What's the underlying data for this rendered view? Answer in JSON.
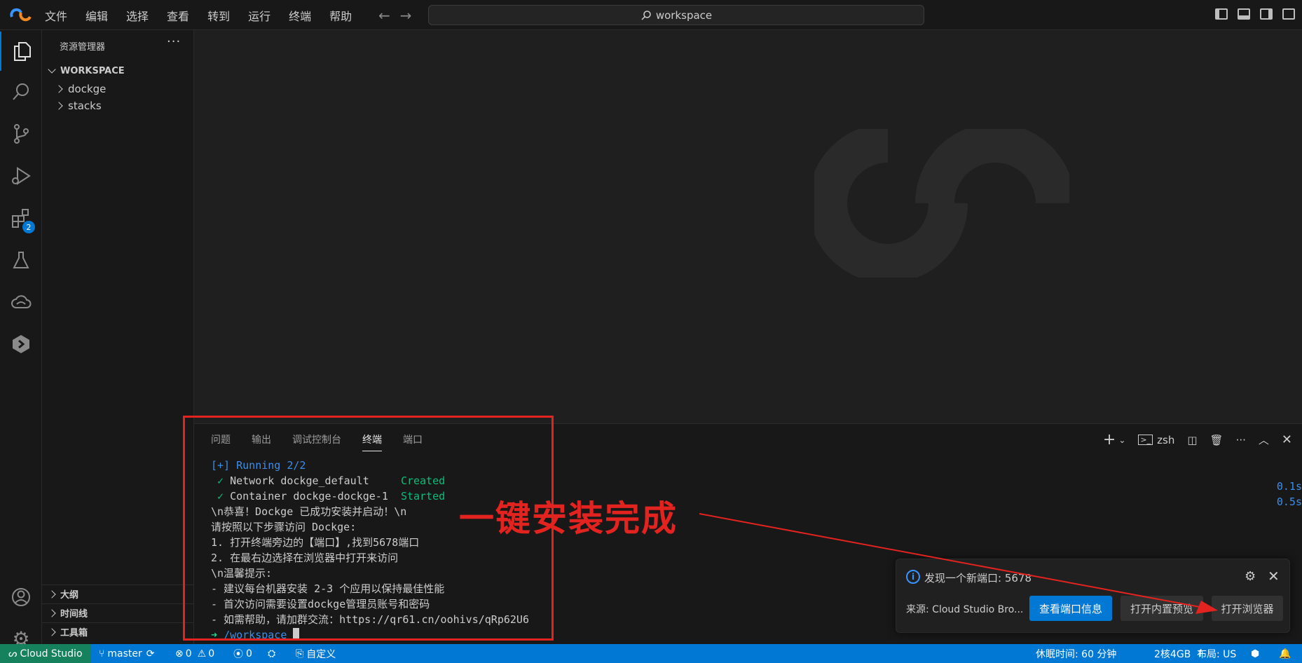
{
  "menu": [
    "文件",
    "编辑",
    "选择",
    "查看",
    "转到",
    "运行",
    "终端",
    "帮助"
  ],
  "search": {
    "text": "workspace"
  },
  "activity": {
    "extensions_badge": "2"
  },
  "sidebar": {
    "title": "资源管理器",
    "more": "···",
    "workspace_label": "WORKSPACE",
    "folders": [
      "dockge",
      "stacks"
    ],
    "sections": [
      "大纲",
      "时间线",
      "工具箱"
    ]
  },
  "panel": {
    "tabs": [
      "问题",
      "输出",
      "调试控制台",
      "终端",
      "端口"
    ],
    "active_tab": "终端",
    "shell": "zsh"
  },
  "terminal": {
    "running": "[+] Running 2/2",
    "net_check": "✓",
    "net_text": "Network dockge_default",
    "net_status": "Created",
    "cont_check": "✓",
    "cont_text": "Container dockge-dockge-1",
    "cont_status": "Started",
    "lines": [
      "\\n恭喜！Dockge 已成功安装并启动！\\n",
      "请按照以下步骤访问 Dockge:",
      "1. 打开终端旁边的【端口】,找到5678端口",
      "2. 在最右边选择在浏览器中打开来访问",
      "\\n温馨提示:",
      "- 建议每台机器安装 2-3 个应用以保持最佳性能",
      "- 首次访问需要设置dockge管理员账号和密码",
      "- 如需帮助，请加群交流：https://qr61.cn/oohivs/qRp62U6"
    ],
    "prompt_arrow": "➜",
    "prompt_dir": "/workspace",
    "times": [
      "0.1s",
      "0.5s"
    ]
  },
  "annotation": {
    "text": "一键安装完成",
    "color": "#e3231f"
  },
  "toast": {
    "message": "发现一个新端口: 5678",
    "source": "来源: Cloud Studio Bro...",
    "btn_view_port": "查看端口信息",
    "btn_preview": "打开内置预览",
    "btn_browser": "打开浏览器"
  },
  "statusbar": {
    "remote": "Cloud Studio",
    "branch": "master",
    "errors": "0",
    "warnings": "0",
    "ports": "0",
    "custom": "自定义",
    "sleep": "休眠时间: 60 分钟",
    "spec": "2核4GB",
    "layout": "布局: US"
  },
  "colors": {
    "accent": "#0078d4",
    "status_remote": "#16825d",
    "terminal_blue": "#3b8eea",
    "terminal_green": "#23d18b"
  }
}
